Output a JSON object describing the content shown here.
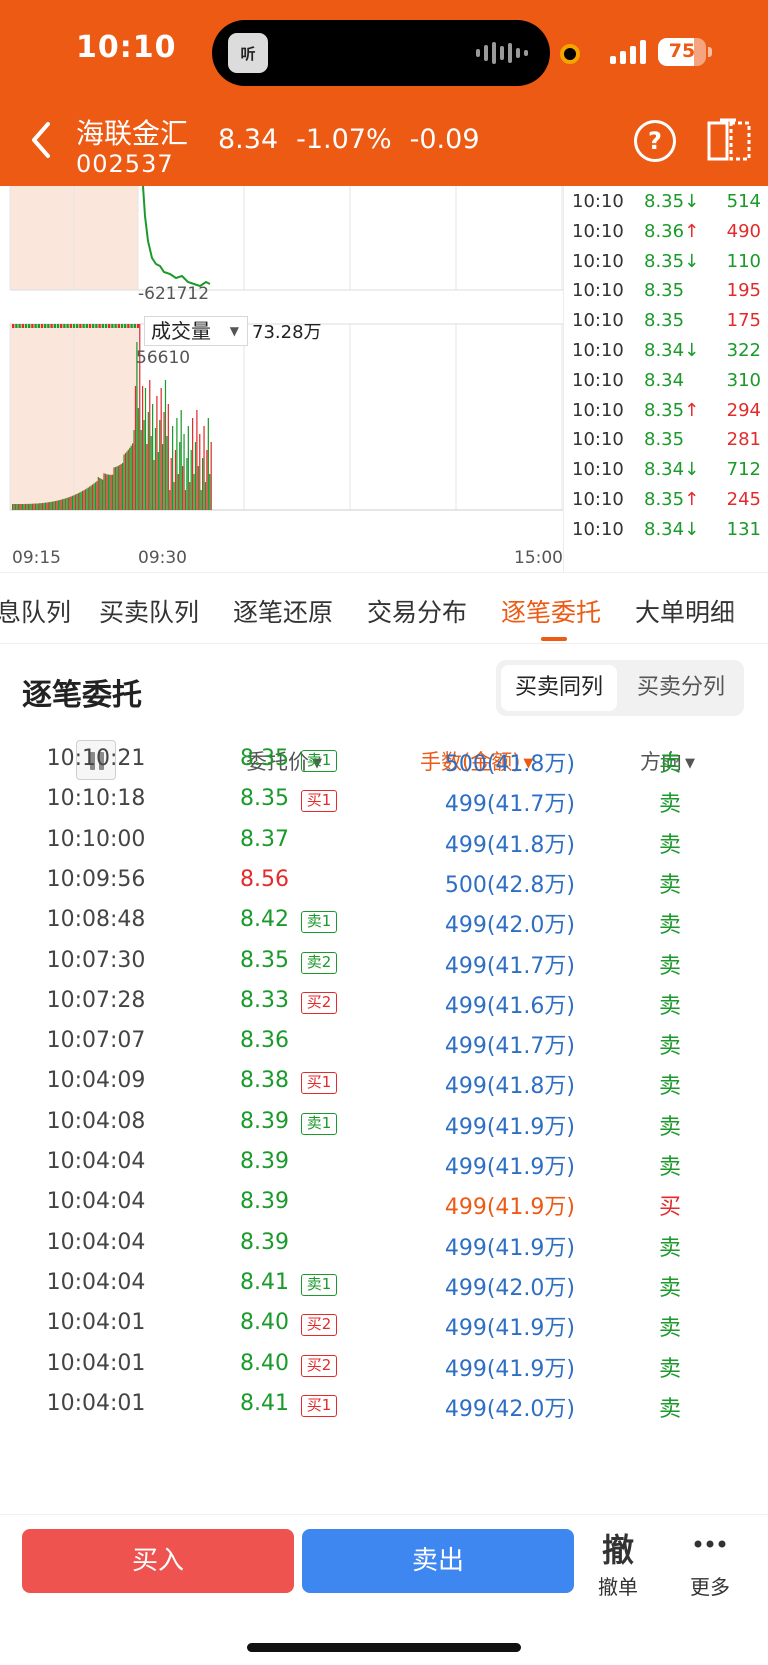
{
  "status_bar": {
    "time": "10:10",
    "island_app_label": "听",
    "battery": "75",
    "battery_level": 0.75
  },
  "header": {
    "stock_name": "海联金汇",
    "stock_code": "002537",
    "price": "8.34",
    "change_pct": "-1.07%",
    "change": "-0.09"
  },
  "chart": {
    "price_low_label": "-621712",
    "volume_selector": "成交量",
    "volume_total": "73.28万",
    "volume_max_label": "56610",
    "x_axis": [
      "09:15",
      "09:30",
      "15:00"
    ],
    "colors": {
      "up": "#e32b2b",
      "down": "#1a9a2a",
      "line": "#1a9a2a",
      "auction_bg": "#fbe6dc"
    }
  },
  "chart_data": {
    "type": "bar",
    "title": "成交量",
    "xlabel": "",
    "ylabel": "",
    "x_ticks": [
      "09:15",
      "09:30",
      "15:00"
    ],
    "ylim": [
      0,
      56610
    ],
    "grid": true
  },
  "ticks": [
    {
      "time": "10:10",
      "price": "8.35",
      "arrow": "↓",
      "vol": "514",
      "vol_color": "green"
    },
    {
      "time": "10:10",
      "price": "8.36",
      "arrow": "↑",
      "vol": "490",
      "vol_color": "red"
    },
    {
      "time": "10:10",
      "price": "8.35",
      "arrow": "↓",
      "vol": "110",
      "vol_color": "green"
    },
    {
      "time": "10:10",
      "price": "8.35",
      "arrow": "",
      "vol": "195",
      "vol_color": "red"
    },
    {
      "time": "10:10",
      "price": "8.35",
      "arrow": "",
      "vol": "175",
      "vol_color": "red"
    },
    {
      "time": "10:10",
      "price": "8.34",
      "arrow": "↓",
      "vol": "322",
      "vol_color": "green"
    },
    {
      "time": "10:10",
      "price": "8.34",
      "arrow": "",
      "vol": "310",
      "vol_color": "green"
    },
    {
      "time": "10:10",
      "price": "8.35",
      "arrow": "↑",
      "vol": "294",
      "vol_color": "red"
    },
    {
      "time": "10:10",
      "price": "8.35",
      "arrow": "",
      "vol": "281",
      "vol_color": "red"
    },
    {
      "time": "10:10",
      "price": "8.34",
      "arrow": "↓",
      "vol": "712",
      "vol_color": "green"
    },
    {
      "time": "10:10",
      "price": "8.35",
      "arrow": "↑",
      "vol": "245",
      "vol_color": "red"
    },
    {
      "time": "10:10",
      "price": "8.34",
      "arrow": "↓",
      "vol": "131",
      "vol_color": "green"
    }
  ],
  "tabs": [
    "息队列",
    "买卖队列",
    "逐笔还原",
    "交易分布",
    "逐笔委托",
    "大单明细"
  ],
  "active_tab": "逐笔委托",
  "section": {
    "title": "逐笔委托",
    "toggle": [
      "买卖同列",
      "买卖分列"
    ]
  },
  "columns": {
    "price": "委托价",
    "amount": "手数(金额)",
    "direction": "方向"
  },
  "rows": [
    {
      "time": "10:10:21",
      "price": "8.35",
      "price_color": "green",
      "badge": "卖1",
      "badge_color": "green",
      "amount": "500(41.8万)",
      "amount_color": "blue",
      "dir": "卖",
      "dir_color": "green"
    },
    {
      "time": "10:10:18",
      "price": "8.35",
      "price_color": "green",
      "badge": "买1",
      "badge_color": "red",
      "amount": "499(41.7万)",
      "amount_color": "blue",
      "dir": "卖",
      "dir_color": "green"
    },
    {
      "time": "10:10:00",
      "price": "8.37",
      "price_color": "green",
      "badge": "",
      "badge_color": "",
      "amount": "499(41.8万)",
      "amount_color": "blue",
      "dir": "卖",
      "dir_color": "green"
    },
    {
      "time": "10:09:56",
      "price": "8.56",
      "price_color": "red",
      "badge": "",
      "badge_color": "",
      "amount": "500(42.8万)",
      "amount_color": "blue",
      "dir": "卖",
      "dir_color": "green"
    },
    {
      "time": "10:08:48",
      "price": "8.42",
      "price_color": "green",
      "badge": "卖1",
      "badge_color": "green",
      "amount": "499(42.0万)",
      "amount_color": "blue",
      "dir": "卖",
      "dir_color": "green"
    },
    {
      "time": "10:07:30",
      "price": "8.35",
      "price_color": "green",
      "badge": "卖2",
      "badge_color": "green",
      "amount": "499(41.7万)",
      "amount_color": "blue",
      "dir": "卖",
      "dir_color": "green"
    },
    {
      "time": "10:07:28",
      "price": "8.33",
      "price_color": "green",
      "badge": "买2",
      "badge_color": "red",
      "amount": "499(41.6万)",
      "amount_color": "blue",
      "dir": "卖",
      "dir_color": "green"
    },
    {
      "time": "10:07:07",
      "price": "8.36",
      "price_color": "green",
      "badge": "",
      "badge_color": "",
      "amount": "499(41.7万)",
      "amount_color": "blue",
      "dir": "卖",
      "dir_color": "green"
    },
    {
      "time": "10:04:09",
      "price": "8.38",
      "price_color": "green",
      "badge": "买1",
      "badge_color": "red",
      "amount": "499(41.8万)",
      "amount_color": "blue",
      "dir": "卖",
      "dir_color": "green"
    },
    {
      "time": "10:04:08",
      "price": "8.39",
      "price_color": "green",
      "badge": "卖1",
      "badge_color": "green",
      "amount": "499(41.9万)",
      "amount_color": "blue",
      "dir": "卖",
      "dir_color": "green"
    },
    {
      "time": "10:04:04",
      "price": "8.39",
      "price_color": "green",
      "badge": "",
      "badge_color": "",
      "amount": "499(41.9万)",
      "amount_color": "blue",
      "dir": "卖",
      "dir_color": "green"
    },
    {
      "time": "10:04:04",
      "price": "8.39",
      "price_color": "green",
      "badge": "",
      "badge_color": "",
      "amount": "499(41.9万)",
      "amount_color": "orange",
      "dir": "买",
      "dir_color": "red"
    },
    {
      "time": "10:04:04",
      "price": "8.39",
      "price_color": "green",
      "badge": "",
      "badge_color": "",
      "amount": "499(41.9万)",
      "amount_color": "blue",
      "dir": "卖",
      "dir_color": "green"
    },
    {
      "time": "10:04:04",
      "price": "8.41",
      "price_color": "green",
      "badge": "卖1",
      "badge_color": "green",
      "amount": "499(42.0万)",
      "amount_color": "blue",
      "dir": "卖",
      "dir_color": "green"
    },
    {
      "time": "10:04:01",
      "price": "8.40",
      "price_color": "green",
      "badge": "买2",
      "badge_color": "red",
      "amount": "499(41.9万)",
      "amount_color": "blue",
      "dir": "卖",
      "dir_color": "green"
    },
    {
      "time": "10:04:01",
      "price": "8.40",
      "price_color": "green",
      "badge": "买2",
      "badge_color": "red",
      "amount": "499(41.9万)",
      "amount_color": "blue",
      "dir": "卖",
      "dir_color": "green"
    },
    {
      "time": "10:04:01",
      "price": "8.41",
      "price_color": "green",
      "badge": "买1",
      "badge_color": "red",
      "amount": "499(42.0万)",
      "amount_color": "blue",
      "dir": "卖",
      "dir_color": "green"
    }
  ],
  "bottom_bar": {
    "buy": "买入",
    "sell": "卖出",
    "cancel_icon_char": "撤",
    "cancel": "撤单",
    "more": "更多"
  },
  "icons": [
    "back-arrow-icon",
    "help-icon",
    "switch-view-icon",
    "pause-icon",
    "more-dots-icon"
  ]
}
